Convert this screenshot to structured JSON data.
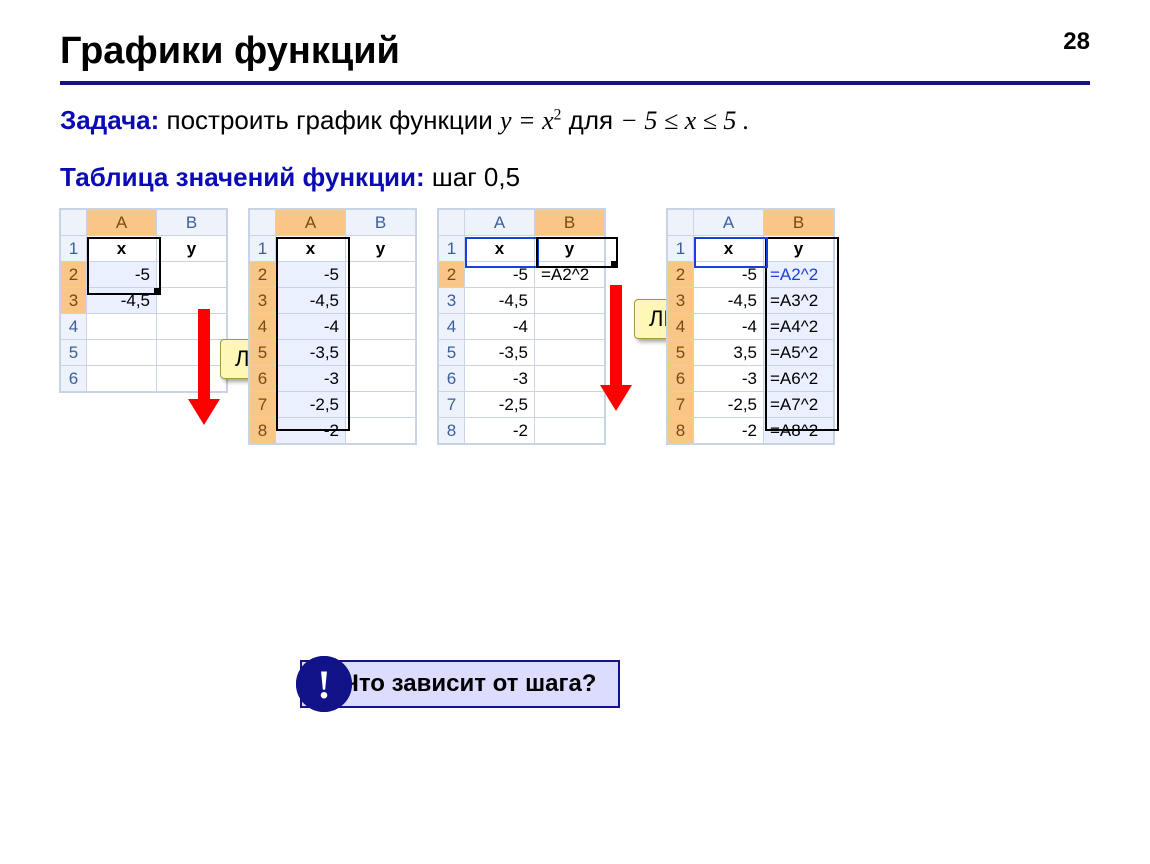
{
  "page_number": "28",
  "title": "Графики функций",
  "task_label": "Задача:",
  "task_text": " построить график функции ",
  "task_formula_lhs": "y = x",
  "task_formula_sup": "2",
  "task_for": "  для  ",
  "task_range": "− 5 ≤ x ≤ 5 .",
  "table_label": "Таблица значений функции:",
  "step_text": "  шаг 0,5",
  "cols": {
    "a": "A",
    "b": "B"
  },
  "headers": {
    "x": "x",
    "y": "y"
  },
  "lkm": "ЛКМ",
  "sheet1_rows": [
    {
      "n": "1",
      "a": "x",
      "b": "y"
    },
    {
      "n": "2",
      "a": "-5",
      "b": ""
    },
    {
      "n": "3",
      "a": "-4,5",
      "b": ""
    },
    {
      "n": "4",
      "a": "",
      "b": ""
    },
    {
      "n": "5",
      "a": "",
      "b": ""
    },
    {
      "n": "6",
      "a": "",
      "b": ""
    }
  ],
  "sheet2_rows": [
    {
      "n": "1",
      "a": "x",
      "b": "y"
    },
    {
      "n": "2",
      "a": "-5",
      "b": ""
    },
    {
      "n": "3",
      "a": "-4,5",
      "b": ""
    },
    {
      "n": "4",
      "a": "-4",
      "b": ""
    },
    {
      "n": "5",
      "a": "-3,5",
      "b": ""
    },
    {
      "n": "6",
      "a": "-3",
      "b": ""
    },
    {
      "n": "7",
      "a": "-2,5",
      "b": ""
    },
    {
      "n": "8",
      "a": "-2",
      "b": ""
    }
  ],
  "sheet3_rows": [
    {
      "n": "1",
      "a": "x",
      "b": "y"
    },
    {
      "n": "2",
      "a": "-5",
      "b": "=A2^2"
    },
    {
      "n": "3",
      "a": "-4,5",
      "b": ""
    },
    {
      "n": "4",
      "a": "-4",
      "b": ""
    },
    {
      "n": "5",
      "a": "-3,5",
      "b": ""
    },
    {
      "n": "6",
      "a": "-3",
      "b": ""
    },
    {
      "n": "7",
      "a": "-2,5",
      "b": ""
    },
    {
      "n": "8",
      "a": "-2",
      "b": ""
    }
  ],
  "sheet4_rows": [
    {
      "n": "1",
      "a": "x",
      "b": "y"
    },
    {
      "n": "2",
      "a": "-5",
      "b": "=A2^2"
    },
    {
      "n": "3",
      "a": "-4,5",
      "b": "=A3^2"
    },
    {
      "n": "4",
      "a": "-4",
      "b": "=A4^2"
    },
    {
      "n": "5",
      "a": "3,5",
      "b": "=A5^2"
    },
    {
      "n": "6",
      "a": "-3",
      "b": "=A6^2"
    },
    {
      "n": "7",
      "a": "-2,5",
      "b": "=A7^2"
    },
    {
      "n": "8",
      "a": "-2",
      "b": "=A8^2"
    }
  ],
  "note_mark": "!",
  "note_text": "Что зависит от шага?"
}
